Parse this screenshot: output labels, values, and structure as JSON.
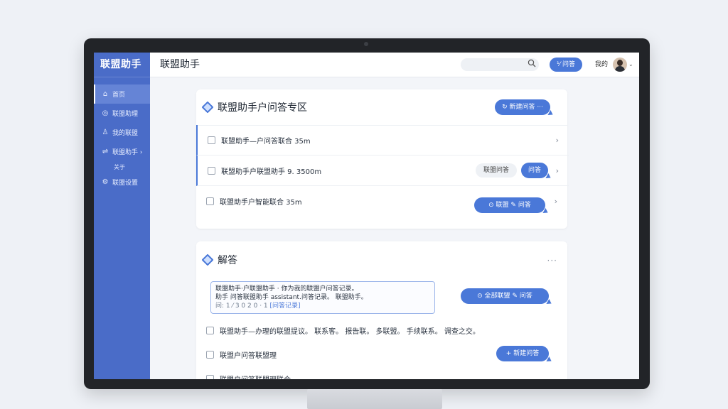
{
  "app": {
    "brand": "联盟助手",
    "header_title": "联盟助手",
    "header_button": "⅟ 问答",
    "header_user": "我的"
  },
  "sidebar": {
    "items": [
      {
        "icon": "home-icon",
        "glyph": "⌂",
        "label": "首页"
      },
      {
        "icon": "chat-icon",
        "glyph": "◎",
        "label": "联盟助理"
      },
      {
        "icon": "user-icon",
        "glyph": "♙",
        "label": "我的联盟"
      },
      {
        "icon": "share-icon",
        "glyph": "⇌",
        "label": "联盟助手 ›"
      },
      {
        "icon": "settings-icon",
        "glyph": "⚙",
        "label": "联盟设置"
      }
    ],
    "sub_item": "关于"
  },
  "qa_card": {
    "title": "联盟助手户问答专区",
    "action_button": "↻ 新建问答 ···",
    "rows": [
      {
        "text": "联盟助手—户问答联合 35m"
      },
      {
        "text": "联盟助手户联盟助手 9. 3500m",
        "tag": "联盟问答",
        "button": "问答"
      },
      {
        "text": "联盟助手户智能联合 35m",
        "button": "⊙ 联盟 ✎ 问答"
      }
    ]
  },
  "answer_card": {
    "title": "解答",
    "more": "···",
    "answer_line1": "联盟助手·户联盟助手 · 你为我的联盟户问答记录。",
    "answer_line2": "助手 问答联盟助手 assistant.问答记录。 联盟助手。",
    "answer_line3": "问: 1 ⁄ 3 0 2 0 · 1 ",
    "answer_link": "[问答记录]",
    "answer_button": "⊙ 全部联盟 ✎ 问答",
    "item1": "联盟助手—办理的联盟提议。 联系客。 报告联。 多联盟。 手续联系。 调查之交。",
    "item2": "联盟户问答联盟理",
    "item2_button": "+ 新建问答",
    "item3": "联盟户问答联盟理联合"
  },
  "colors": {
    "accent": "#4a78d8",
    "sidebar": "#4a6cc8"
  }
}
